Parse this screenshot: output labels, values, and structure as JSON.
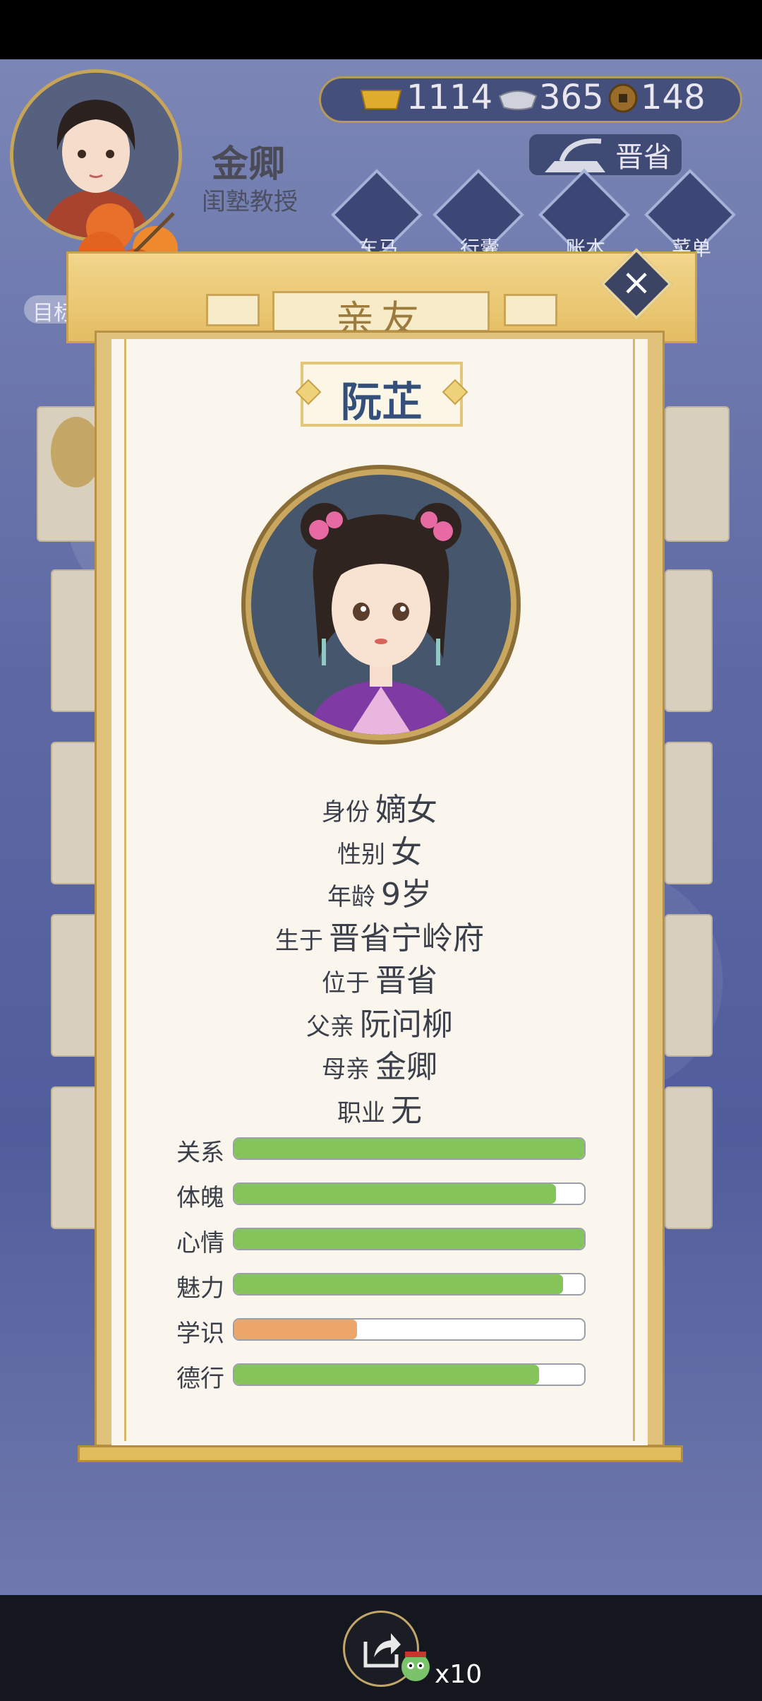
{
  "hud": {
    "player_name": "金卿",
    "player_title": "闺塾教授",
    "currencies": [
      {
        "icon": "gold-ingot-icon",
        "value": "1114"
      },
      {
        "icon": "silver-ingot-icon",
        "value": "365"
      },
      {
        "icon": "copper-coin-icon",
        "value": "148"
      }
    ],
    "region": "晋省",
    "menu": [
      {
        "icon": "carriage-icon",
        "label": "车马"
      },
      {
        "icon": "pouch-icon",
        "label": "行囊"
      },
      {
        "icon": "ledger-icon",
        "label": "账本"
      },
      {
        "icon": "more-icon",
        "label": "菜单"
      }
    ],
    "goal_label": "目标"
  },
  "panel": {
    "heading": "亲友",
    "character_name": "阮芷",
    "info": [
      {
        "key": "身份",
        "value": "嫡女"
      },
      {
        "key": "性别",
        "value": "女"
      },
      {
        "key": "年龄",
        "value": "9岁"
      },
      {
        "key": "生于",
        "value": "晋省宁岭府"
      },
      {
        "key": "位于",
        "value": "晋省"
      },
      {
        "key": "父亲",
        "value": "阮问柳"
      },
      {
        "key": "母亲",
        "value": "金卿"
      },
      {
        "key": "职业",
        "value": "无"
      }
    ],
    "stats": [
      {
        "label": "关系",
        "value": 1.0,
        "color": "#84c458"
      },
      {
        "label": "体魄",
        "value": 0.92,
        "color": "#84c458"
      },
      {
        "label": "心情",
        "value": 1.0,
        "color": "#84c458"
      },
      {
        "label": "魅力",
        "value": 0.94,
        "color": "#84c458"
      },
      {
        "label": "学识",
        "value": 0.35,
        "color": "#eda66a"
      },
      {
        "label": "德行",
        "value": 0.87,
        "color": "#84c458"
      }
    ]
  },
  "bottom": {
    "share_count": "x10"
  }
}
